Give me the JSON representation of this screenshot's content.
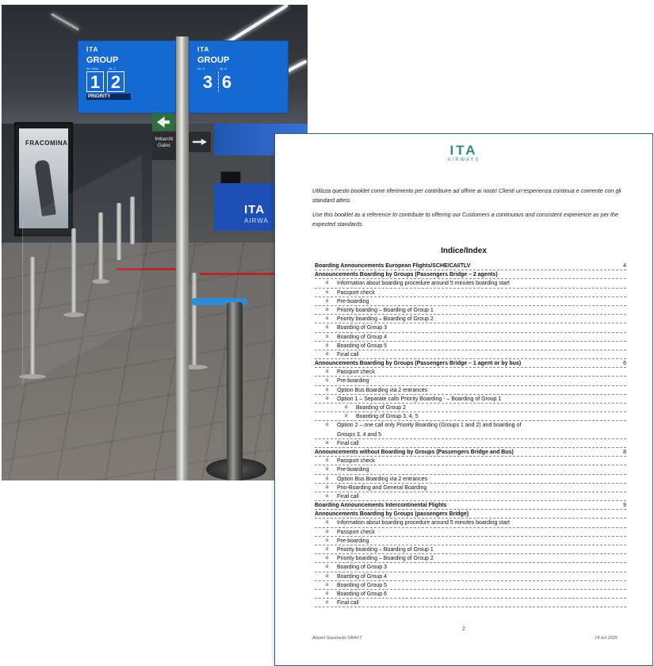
{
  "photo": {
    "signs": [
      {
        "brand": "ITA",
        "group_label": "GROUP",
        "sub_left": "Gr. Prior.",
        "sub_right": "Gr. 2",
        "num_left": "1",
        "num_right": "2",
        "badge": "PRIORITY"
      },
      {
        "brand": "ITA",
        "group_label": "GROUP",
        "sub_left": "Gr. 3",
        "sub_right": "Gr. 6",
        "num_left": "3",
        "num_right": "6",
        "badge": ""
      }
    ],
    "ad_text": "FRACOMINA",
    "gate_sign": "Imbarchi Gates",
    "desk_logo": "ITA",
    "desk_logo_sub": "AIRWA"
  },
  "document": {
    "logo": "ITA",
    "logo_sub": "AIRWAYS",
    "intro_it": "Utilizza questo booklet come riferimento per contribuire ad offrire ai nostri Clienti un’esperienza continua e coerente con gli standard attesi.",
    "intro_en": "Use this booklet as a reference to contribute to offering our Customers a continuous and consistent experience as per the expected standards.",
    "toc_title": "Indice/Index",
    "toc": [
      {
        "level": 0,
        "bold": true,
        "text": "Boarding Announcements European Flights/SCHE/CAI/TLV",
        "page": "4"
      },
      {
        "level": 0,
        "bold": true,
        "text": "Announcements Boarding by Groups (Passengers Bridge – 2 agents)",
        "page": ""
      },
      {
        "level": 1,
        "bold": false,
        "text": "Information about boarding procedure around 5 minutes boarding start",
        "page": ""
      },
      {
        "level": 1,
        "bold": false,
        "text": "Passport check",
        "page": ""
      },
      {
        "level": 1,
        "bold": false,
        "text": "Pre-boarding",
        "page": ""
      },
      {
        "level": 1,
        "bold": false,
        "text": "Priority boarding – Boarding of Group 1",
        "page": ""
      },
      {
        "level": 1,
        "bold": false,
        "text": "Priority boarding – Boarding of Group 2",
        "page": ""
      },
      {
        "level": 1,
        "bold": false,
        "text": "Boarding of Group 3",
        "page": ""
      },
      {
        "level": 1,
        "bold": false,
        "text": "Boarding of Group 4",
        "page": ""
      },
      {
        "level": 1,
        "bold": false,
        "text": "Boarding of Group 5",
        "page": ""
      },
      {
        "level": 1,
        "bold": false,
        "text": "Final call",
        "page": ""
      },
      {
        "level": 0,
        "bold": true,
        "text": "Announcements Boarding by Groups (Passengers Bridge – 1 agent or by bus)",
        "page": "6"
      },
      {
        "level": 1,
        "bold": false,
        "text": "Passport check",
        "page": ""
      },
      {
        "level": 1,
        "bold": false,
        "text": "Pre-boarding",
        "page": ""
      },
      {
        "level": 1,
        "bold": false,
        "text": "Option Bus Boarding via 2 entrances",
        "page": ""
      },
      {
        "level": 1,
        "bold": false,
        "text": "Option 1 – Separate calls Priority Boarding - – Boarding of Group 1",
        "page": ""
      },
      {
        "level": 2,
        "bold": false,
        "text": "Boarding of Group 2",
        "page": ""
      },
      {
        "level": 2,
        "bold": false,
        "text": "Boarding of Group 3, 4, 5",
        "page": ""
      },
      {
        "level": 1,
        "bold": false,
        "text": "Option 2 – one call only Priority Boarding (Groups 1 and 2) and boarding of",
        "page": "",
        "nodash": true
      },
      {
        "level": 1,
        "bold": false,
        "text": "Groups 3, 4 and 5",
        "page": "",
        "cont": true
      },
      {
        "level": 1,
        "bold": false,
        "text": "Final call",
        "page": ""
      },
      {
        "level": 0,
        "bold": true,
        "text": "Announcements without Boarding by Groups (Passengers Bridge and Bus)",
        "page": "8"
      },
      {
        "level": 1,
        "bold": false,
        "text": "Passport check",
        "page": ""
      },
      {
        "level": 1,
        "bold": false,
        "text": "Pre-boarding",
        "page": ""
      },
      {
        "level": 1,
        "bold": false,
        "text": "Option Bus Boarding via 2 entrances",
        "page": ""
      },
      {
        "level": 1,
        "bold": false,
        "text": "Prio-Boarding and General Boarding",
        "page": ""
      },
      {
        "level": 1,
        "bold": false,
        "text": "Final call",
        "page": ""
      },
      {
        "level": 0,
        "bold": true,
        "text": "Boarding Announcements Intercontinental Flights",
        "page": "9"
      },
      {
        "level": 0,
        "bold": true,
        "text": "Announcements Boarding by Groups (passengers Bridge)",
        "page": ""
      },
      {
        "level": 1,
        "bold": false,
        "text": "Information about boarding procedure around 5 minutes boarding start",
        "page": ""
      },
      {
        "level": 1,
        "bold": false,
        "text": "Passport check",
        "page": ""
      },
      {
        "level": 1,
        "bold": false,
        "text": "Pre-boarding",
        "page": ""
      },
      {
        "level": 1,
        "bold": false,
        "text": "Priority boarding – Boarding of Group 1",
        "page": ""
      },
      {
        "level": 1,
        "bold": false,
        "text": "Priority boarding – Boarding of Group 2",
        "page": ""
      },
      {
        "level": 1,
        "bold": false,
        "text": "Boarding of Group 3",
        "page": ""
      },
      {
        "level": 1,
        "bold": false,
        "text": "Boarding of Group 4",
        "page": ""
      },
      {
        "level": 1,
        "bold": false,
        "text": "Boarding of Group 5",
        "page": ""
      },
      {
        "level": 1,
        "bold": false,
        "text": "Boarding of Group 6",
        "page": ""
      },
      {
        "level": 1,
        "bold": false,
        "text": "Final call",
        "page": ""
      }
    ],
    "page_number": "2",
    "footer_left": "Airport Standards DRAFT",
    "footer_right": "14 oct 2025"
  },
  "colors": {
    "sign_blue": "#1769d2",
    "logo_green": "#2f8f6b",
    "page_border": "#2f5c8a"
  }
}
